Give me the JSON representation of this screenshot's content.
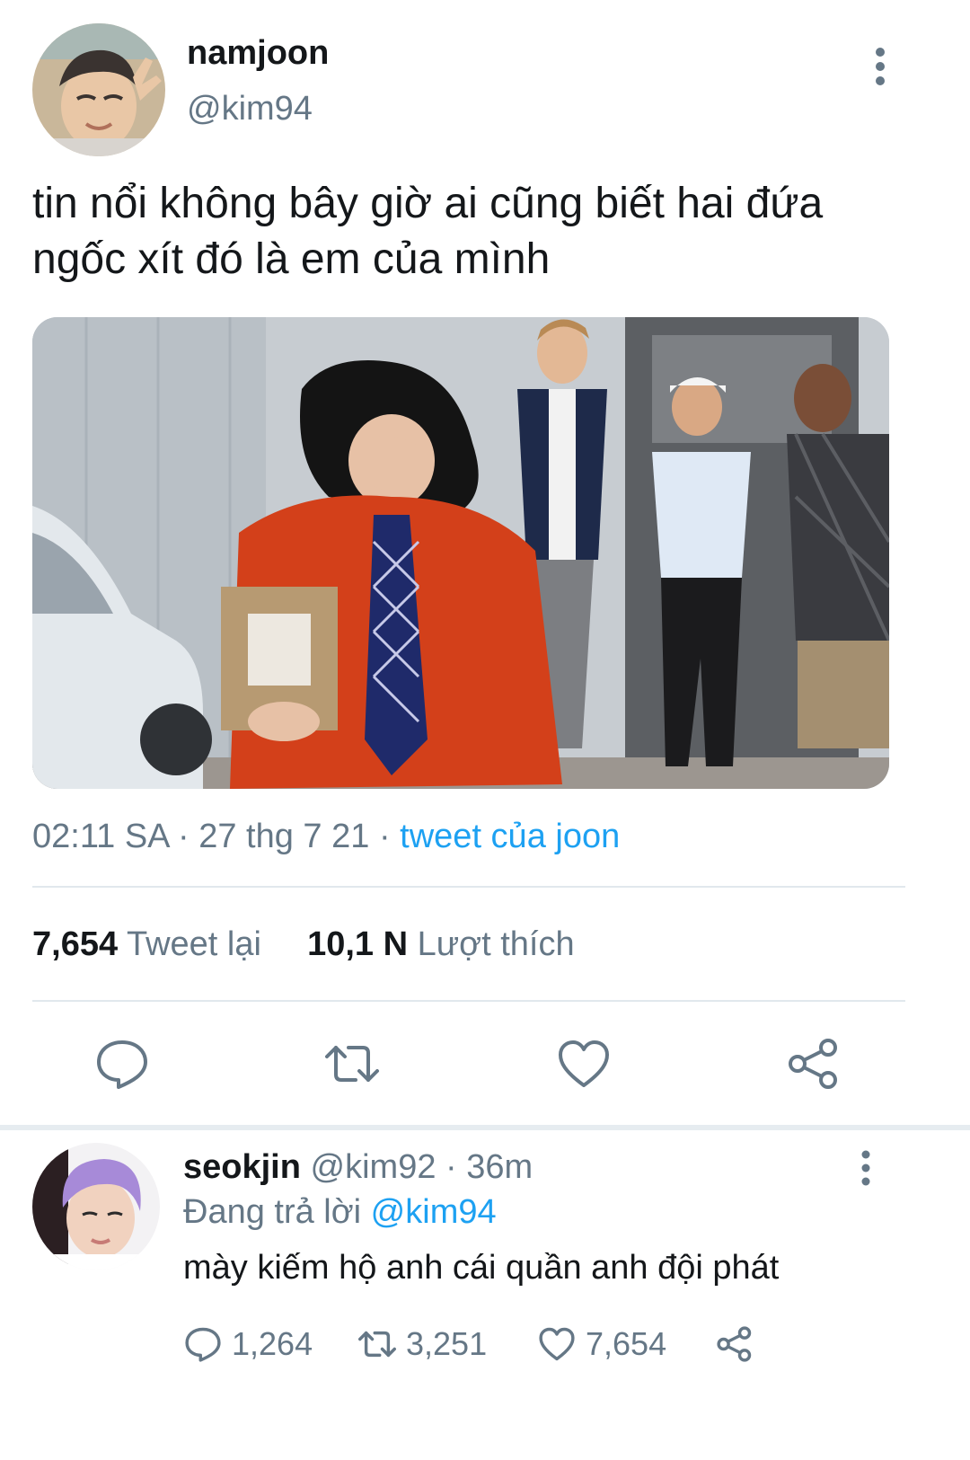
{
  "tweet": {
    "display_name": "namjoon",
    "handle": "@kim94",
    "text_line1": "tin nổi không bây giờ ai cũng biết hai đứa",
    "text_line2": "ngốc xít đó là em của mình",
    "time": "02:11 SA",
    "date": "27 thg 7 21",
    "source": "tweet của joon",
    "retweet_count": "7,654",
    "retweet_label": "Tweet lại",
    "like_count": "10,1 N",
    "like_label": "Lượt thích",
    "avatar_icon": "user-avatar-photo",
    "media_icon": "photo-media"
  },
  "actions": {
    "reply_icon": "comment-icon",
    "retweet_icon": "retweet-icon",
    "like_icon": "heart-icon",
    "share_icon": "share-icon"
  },
  "reply": {
    "display_name": "seokjin",
    "handle": "@kim92",
    "time": "36m",
    "replying_prefix": "Đang trả lời",
    "replying_to": "@kim94",
    "text": "mày kiếm hộ anh cái quần anh đội phát",
    "reply_count": "1,264",
    "retweet_count": "3,251",
    "like_count": "7,654"
  },
  "colors": {
    "link": "#1da1f2",
    "muted": "#657786",
    "divider": "#e1e8ed"
  }
}
